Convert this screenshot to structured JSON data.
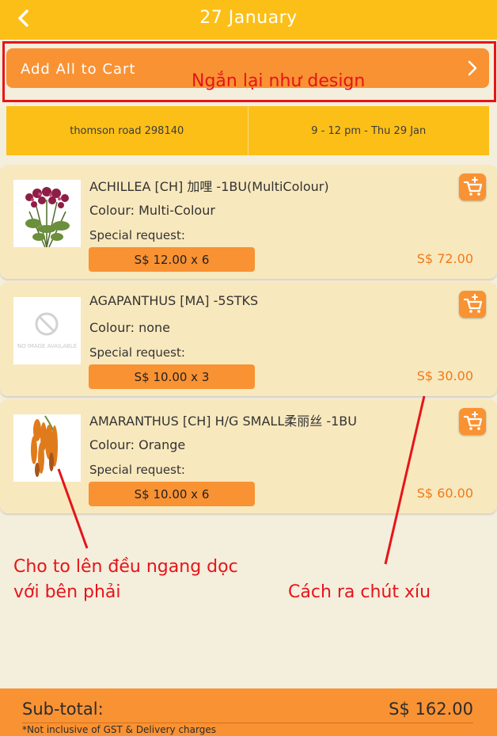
{
  "header": {
    "title": "27  January",
    "back_icon": "chevron-left-icon"
  },
  "add_all": {
    "label": "Add All to Cart",
    "annotation": "Ngắn lại như design"
  },
  "delivery": {
    "address": "thomson road 298140",
    "slot": "9 - 12 pm - Thu 29 Jan"
  },
  "items": [
    {
      "name": "ACHILLEA [CH] 加哩  -1BU(MultiColour)",
      "colour": "Colour: Multi-Colour",
      "special": "Special request:",
      "price": "S$ 12.00 x 6",
      "total": "S$ 72.00"
    },
    {
      "name": "AGAPANTHUS [MA]  -5STKS",
      "colour": "Colour: none",
      "special": "Special request:",
      "price": "S$ 10.00 x 3",
      "total": "S$ 30.00",
      "no_image_text": "NO IMAGE AVAILABLE"
    },
    {
      "name": "AMARANTHUS [CH] H/G SMALL柔丽丝  -1BU",
      "colour": "Colour: Orange",
      "special": "Special request:",
      "price": "S$ 10.00 x 6",
      "total": "S$ 60.00"
    }
  ],
  "notes": {
    "left_line1": "Cho to lên đều ngang dọc",
    "left_line2": "với  bên phải",
    "right": "Cách ra chút xíu"
  },
  "footer": {
    "subtotal_label": "Sub-total:",
    "subtotal_value": "S$ 162.00",
    "disclaimer": "*Not inclusive of GST & Delivery charges"
  },
  "colors": {
    "header": "#fcbf17",
    "accent": "#f99233",
    "annotation": "#e6141b",
    "item_bg": "#f8e8bd",
    "total_text": "#f07a1a"
  }
}
